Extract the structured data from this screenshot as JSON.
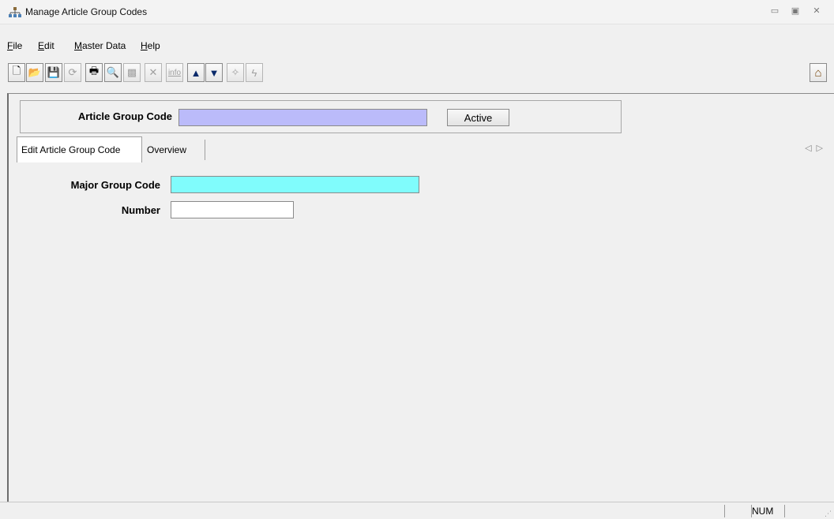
{
  "window": {
    "title": "Manage Article Group Codes",
    "minimize_glyph": "▭",
    "restore_glyph": "▣",
    "close_glyph": "✕"
  },
  "menu": {
    "items": [
      {
        "label": "File",
        "mnemonic": "F",
        "rest": "ile"
      },
      {
        "label": "Edit",
        "mnemonic": "E",
        "rest": "dit"
      },
      {
        "label": "Master Data",
        "mnemonic": "M",
        "rest": "aster Data"
      },
      {
        "label": "Help",
        "mnemonic": "H",
        "rest": "elp"
      }
    ]
  },
  "toolbar": {
    "buttons": [
      {
        "icon": "new-document-icon",
        "glyph": "🗋"
      },
      {
        "icon": "open-folder-icon",
        "glyph": "📂"
      },
      {
        "icon": "save-icon",
        "glyph": "💾"
      },
      {
        "icon": "refresh-icon",
        "glyph": "⟳"
      },
      {
        "icon": "print-icon",
        "glyph": "🖶"
      },
      {
        "icon": "print-preview-icon",
        "glyph": "🔍"
      },
      {
        "icon": "export-icon",
        "glyph": "▩"
      },
      {
        "icon": "delete-icon",
        "glyph": "✕"
      },
      {
        "icon": "info-icon",
        "glyph": "info"
      },
      {
        "icon": "arrow-up-icon",
        "glyph": "▲"
      },
      {
        "icon": "arrow-down-icon",
        "glyph": "▼"
      },
      {
        "icon": "wizard-icon",
        "glyph": "✧"
      },
      {
        "icon": "lightning-icon",
        "glyph": "ϟ"
      }
    ],
    "home_icon": "home-icon",
    "home_glyph": "⌂"
  },
  "header": {
    "article_group_code_label": "Article Group Code",
    "article_group_code_value": "",
    "active_button_label": "Active"
  },
  "tabs": [
    {
      "label": "Edit Article Group Code",
      "selected": true
    },
    {
      "label": "Overview",
      "selected": false
    }
  ],
  "tab_scroll": {
    "left_glyph": "◁",
    "right_glyph": "▷"
  },
  "form": {
    "major_group_code_label": "Major Group Code",
    "major_group_code_value": "",
    "number_label": "Number",
    "number_value": ""
  },
  "statusbar": {
    "num_indicator": "NUM",
    "grip_glyph": "⋰"
  },
  "colors": {
    "required_field": "#bbbbfa",
    "key_field": "#80fcfc",
    "field_default": "#ffffff"
  }
}
